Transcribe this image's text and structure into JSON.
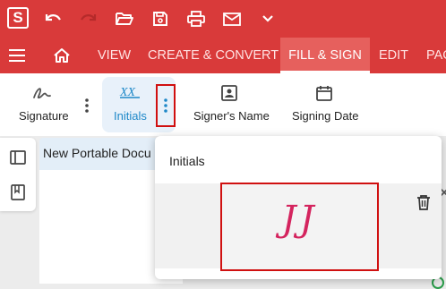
{
  "app": {
    "logo_letter": "S"
  },
  "toolbar": {
    "icons": [
      "undo-icon",
      "redo-icon",
      "open-folder-icon",
      "save-icon",
      "print-icon",
      "mail-icon",
      "chevron-down-icon"
    ]
  },
  "menu": {
    "tabs": [
      {
        "label": "VIEW"
      },
      {
        "label": "CREATE & CONVERT"
      },
      {
        "label": "FILL & SIGN",
        "active": true
      },
      {
        "label": "EDIT"
      },
      {
        "label": "PAC"
      }
    ]
  },
  "ribbon": {
    "signature_label": "Signature",
    "initials_label": "Initials",
    "signers_name_label": "Signer's Name",
    "signing_date_label": "Signing Date"
  },
  "document": {
    "tab_title": "New Portable Docu"
  },
  "popup": {
    "title": "Initials",
    "initials_text": "JJ"
  },
  "colors": {
    "brand_red": "#d93a3a",
    "highlight_red": "#d01010",
    "initials_pink": "#d4245e",
    "accent_blue": "#1e88c8"
  }
}
